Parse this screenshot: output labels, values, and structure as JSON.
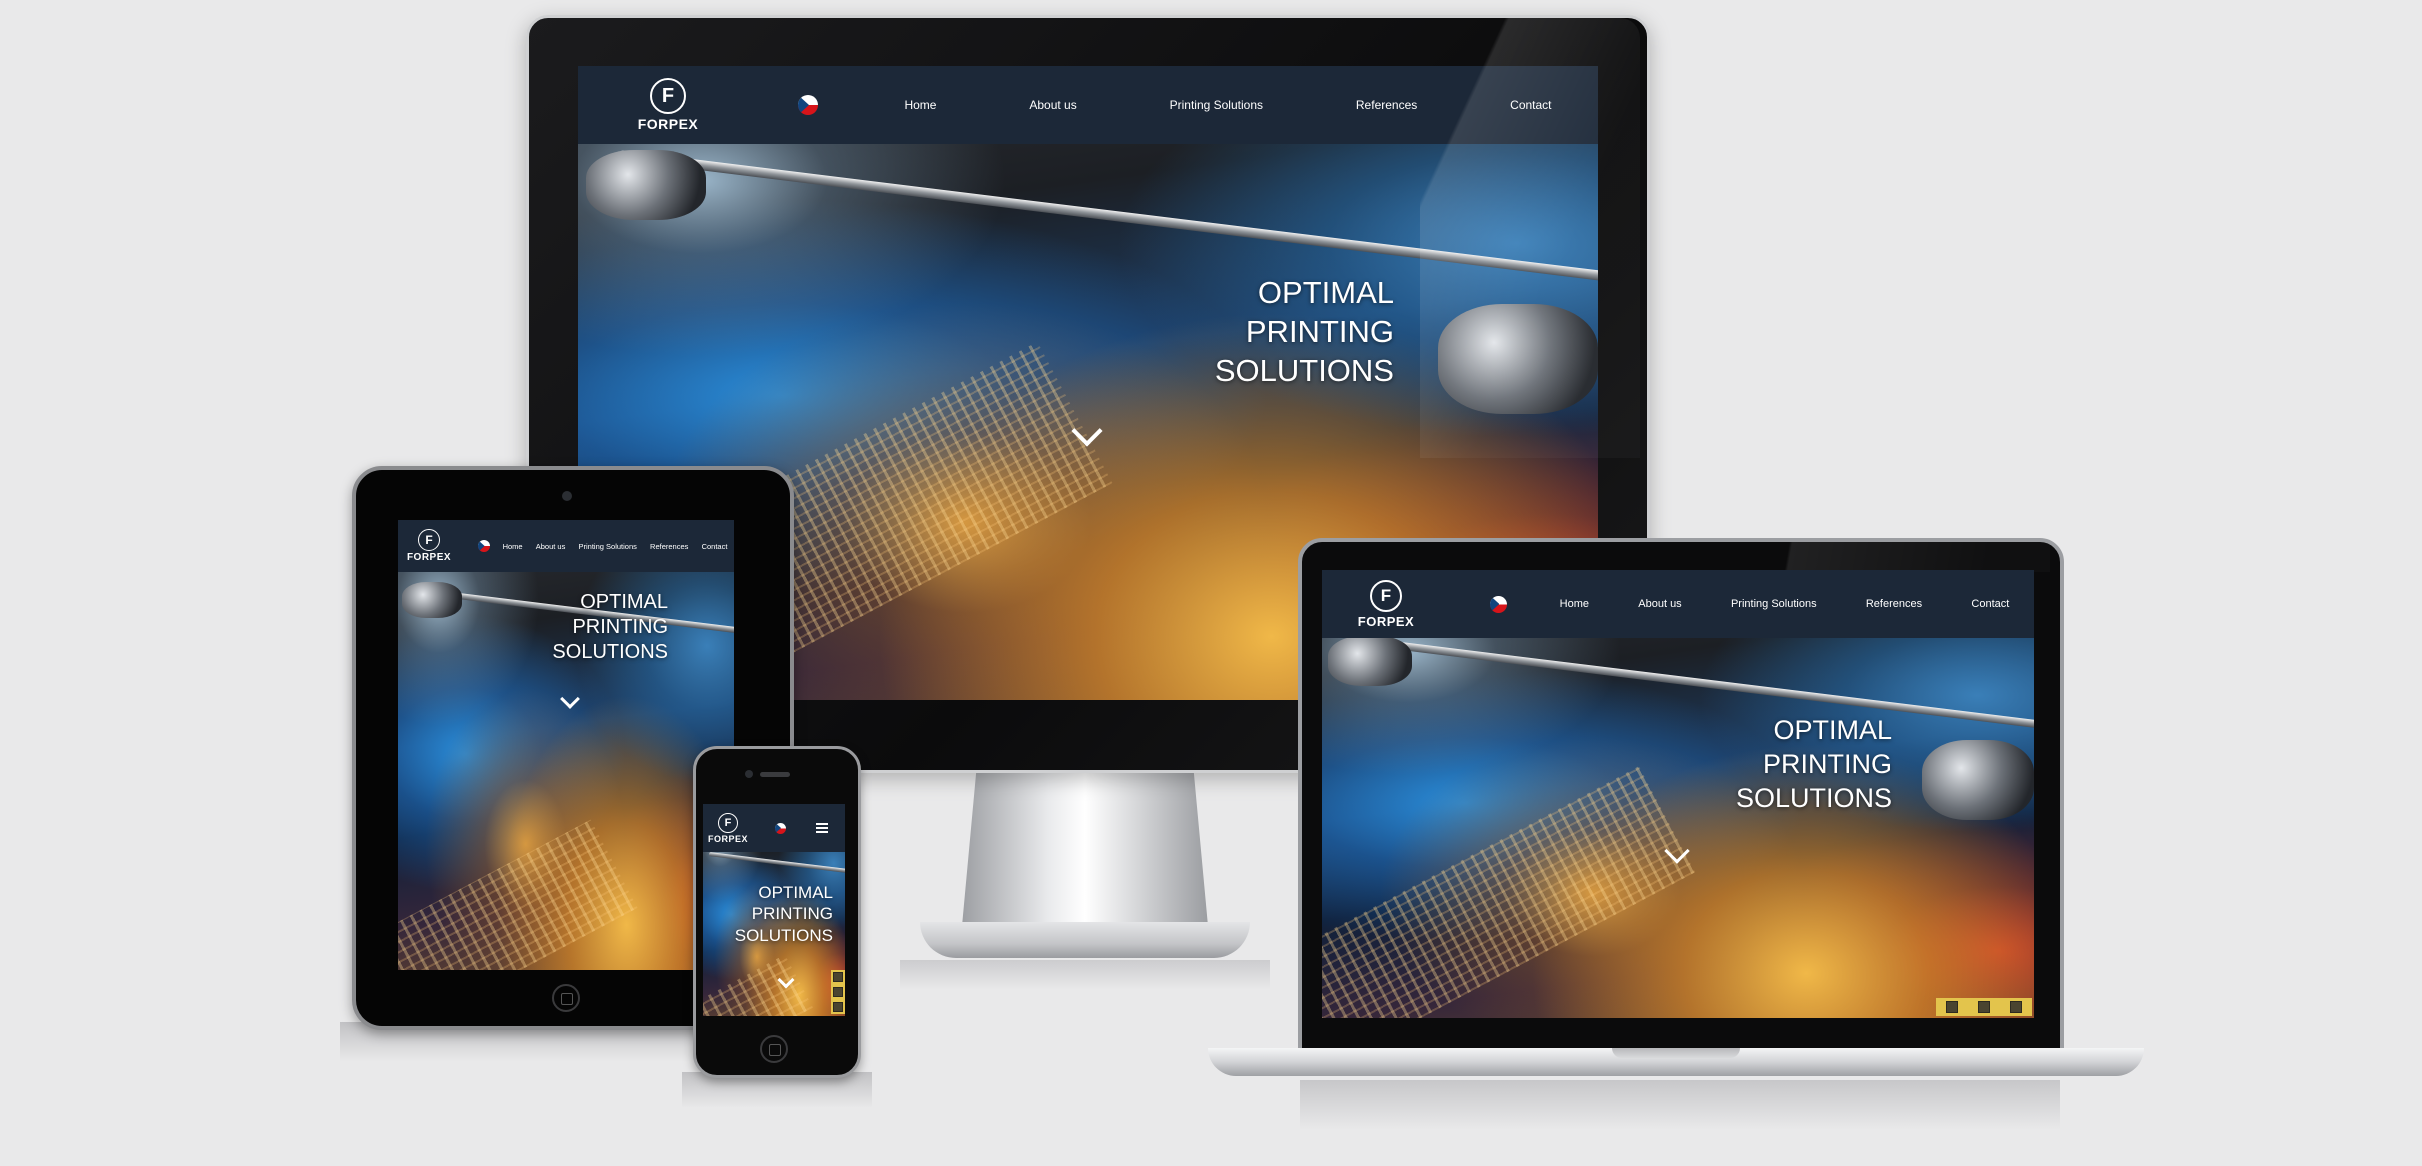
{
  "site": {
    "brand": "FORPEX",
    "logo_letter": "F",
    "language_flag": "czech-flag-icon",
    "nav": [
      "Home",
      "About us",
      "Printing Solutions",
      "References",
      "Contact"
    ],
    "hero": [
      "OPTIMAL",
      "PRINTING",
      "SOLUTIONS"
    ],
    "scroll_icon": "chevron-down-icon",
    "mobile_menu_icon": "hamburger-menu-icon"
  },
  "colors": {
    "page_background": "#e9e9ea",
    "nav_background": "#1c2838",
    "hero_text": "#ffffff",
    "side_widget": "#e3c44c"
  },
  "devices": [
    "desktop-monitor",
    "tablet",
    "smartphone",
    "laptop"
  ]
}
